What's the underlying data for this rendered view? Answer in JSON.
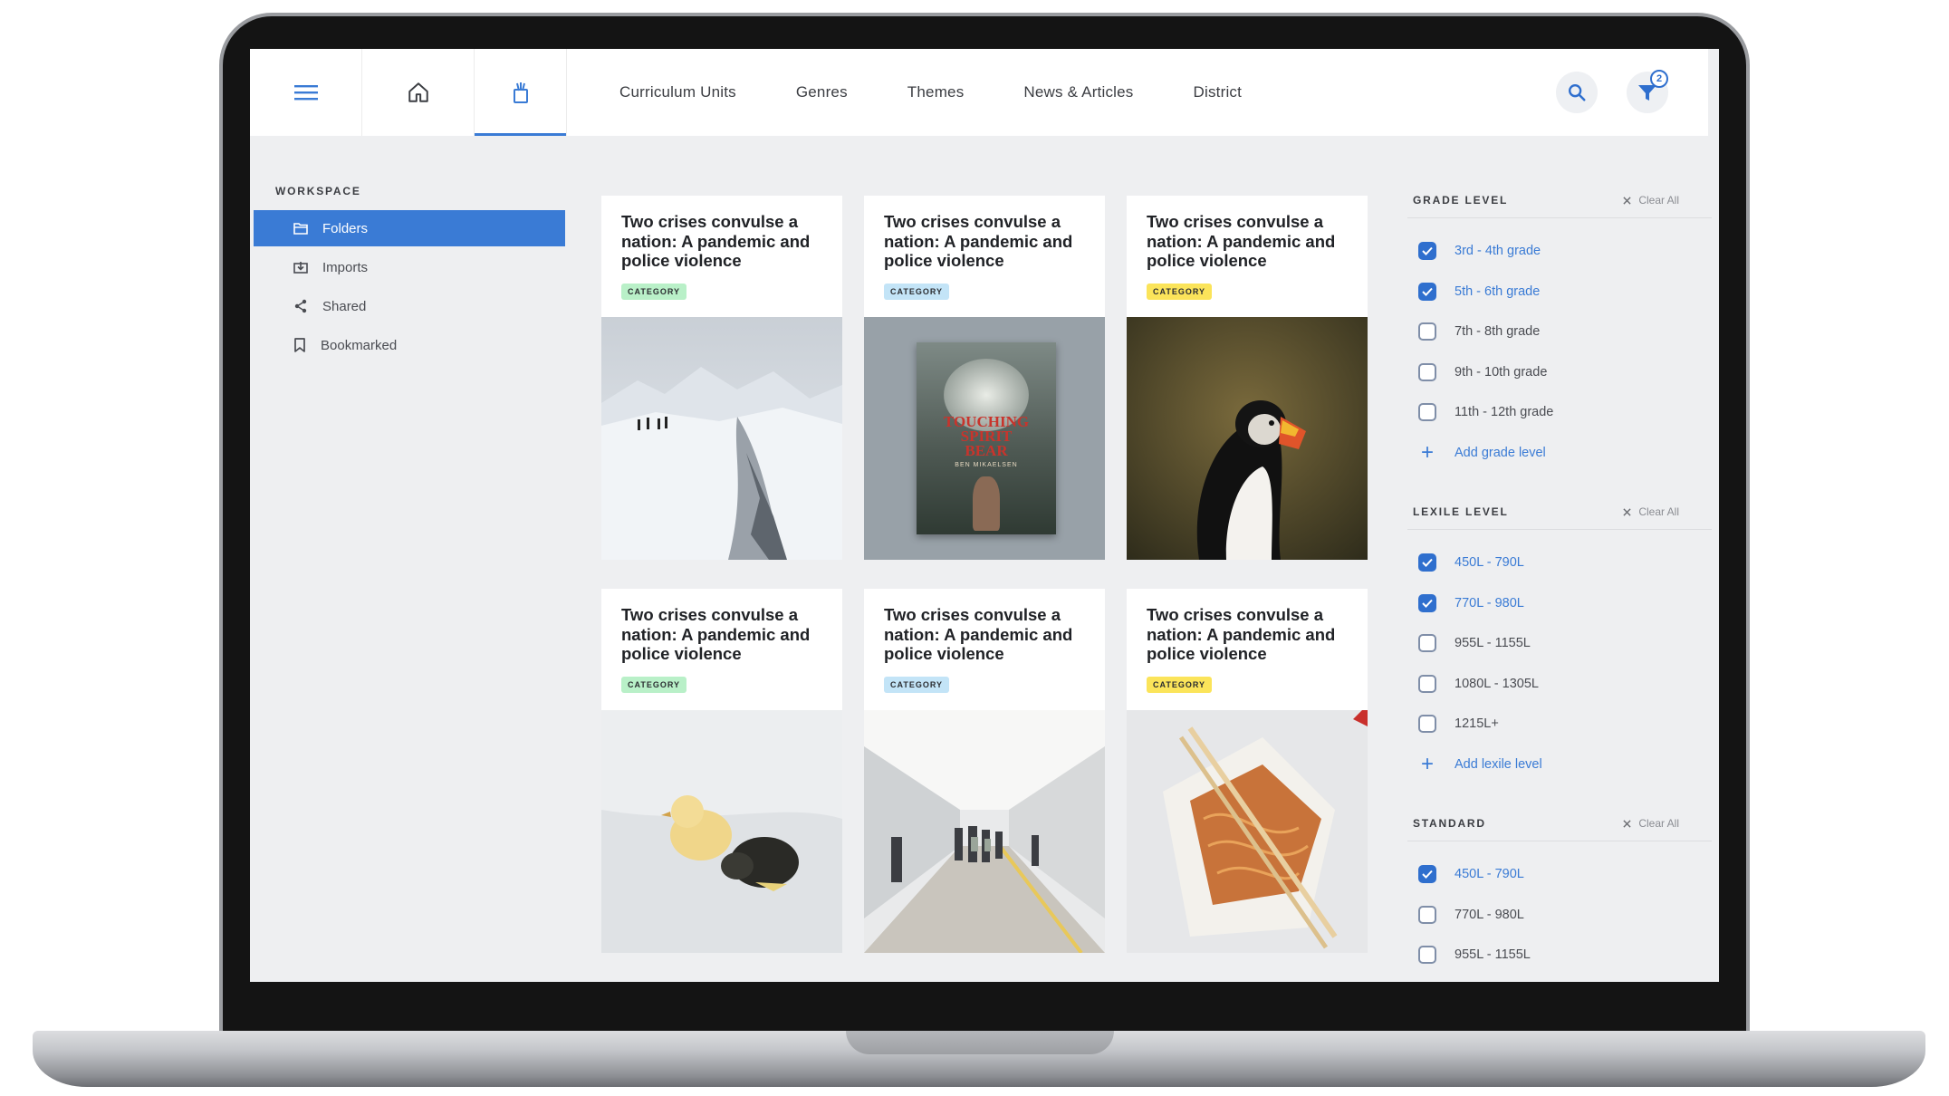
{
  "nav": {
    "links": [
      "Curriculum Units",
      "Genres",
      "Themes",
      "News & Articles",
      "District"
    ],
    "filter_count": "2",
    "accent": "#3a7bd5"
  },
  "sidebar": {
    "section": "WORKSPACE",
    "items": [
      {
        "label": "Folders",
        "icon": "folder-icon",
        "active": true
      },
      {
        "label": "Imports",
        "icon": "import-icon",
        "active": false
      },
      {
        "label": "Shared",
        "icon": "share-icon",
        "active": false
      },
      {
        "label": "Bookmarked",
        "icon": "bookmark-icon",
        "active": false
      }
    ]
  },
  "cards": [
    {
      "title": "Two crises convulse a nation: A pandemic and police violence",
      "badge": "CATEGORY",
      "badge_color": "#b9f0c8",
      "image": "snowy-mountain-hikers"
    },
    {
      "title": "Two crises convulse a nation: A pandemic and police violence",
      "badge": "CATEGORY",
      "badge_color": "#c3e4f7",
      "image": "touching-spirit-bear-book-cover"
    },
    {
      "title": "Two crises convulse a nation: A pandemic and police violence",
      "badge": "CATEGORY",
      "badge_color": "#fbe45a",
      "image": "puffin-bird"
    },
    {
      "title": "Two crises convulse a nation: A pandemic and police violence",
      "badge": "CATEGORY",
      "badge_color": "#b9f0c8",
      "image": "ducklings-on-snow"
    },
    {
      "title": "Two crises convulse a nation: A pandemic and police violence",
      "badge": "CATEGORY",
      "badge_color": "#c3e4f7",
      "image": "people-walking-walkway"
    },
    {
      "title": "Two crises convulse a nation: A pandemic and police violence",
      "badge": "CATEGORY",
      "badge_color": "#fbe45a",
      "image": "takeout-noodles"
    }
  ],
  "book_cover": {
    "title_lines": [
      "TOUCHING",
      "SPIRIT",
      "BEAR"
    ],
    "author": "BEN MIKAELSEN"
  },
  "filters": {
    "clear_label": "Clear All",
    "groups": [
      {
        "title": "GRADE LEVEL",
        "options": [
          {
            "label": "3rd - 4th grade",
            "checked": true
          },
          {
            "label": "5th - 6th grade",
            "checked": true
          },
          {
            "label": "7th - 8th grade",
            "checked": false
          },
          {
            "label": "9th - 10th grade",
            "checked": false
          },
          {
            "label": "11th - 12th grade",
            "checked": false
          }
        ],
        "add_label": "Add grade level"
      },
      {
        "title": "LEXILE LEVEL",
        "options": [
          {
            "label": "450L - 790L",
            "checked": true
          },
          {
            "label": "770L - 980L",
            "checked": true
          },
          {
            "label": "955L - 1155L",
            "checked": false
          },
          {
            "label": "1080L - 1305L",
            "checked": false
          },
          {
            "label": "1215L+",
            "checked": false
          }
        ],
        "add_label": "Add lexile level"
      },
      {
        "title": "STANDARD",
        "options": [
          {
            "label": "450L - 790L",
            "checked": true
          },
          {
            "label": "770L - 980L",
            "checked": false
          },
          {
            "label": "955L - 1155L",
            "checked": false
          }
        ],
        "add_label": ""
      }
    ]
  }
}
